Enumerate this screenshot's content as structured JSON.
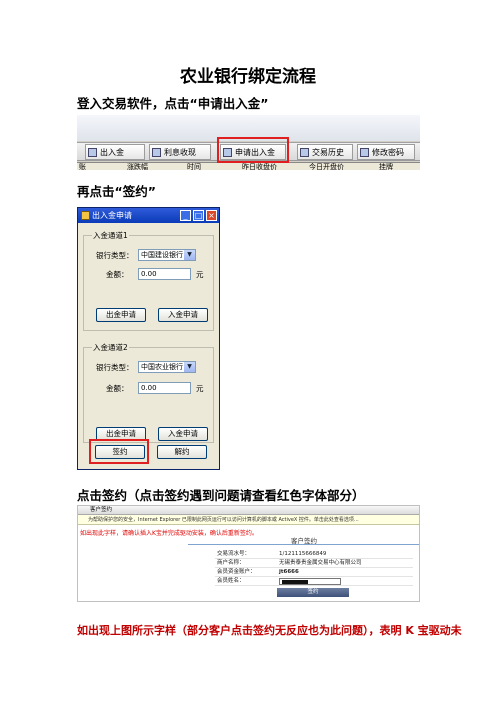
{
  "title": "农业银行绑定流程",
  "step1": "登入交易软件，点击“申请出入金”",
  "toolbar": {
    "buttons": [
      "出入金",
      "利息收现",
      "申请出入金",
      "交易历史",
      "修改密码"
    ],
    "headers": [
      "账",
      "涨跌幅",
      "时间",
      "昨日收盘价",
      "今日开盘价",
      "挂牌"
    ]
  },
  "step2": "再点击“签约”",
  "dialog": {
    "title": "出入金申请",
    "group1": {
      "label": "入金通道1",
      "bank_label": "银行类型：",
      "bank_value": "中国建设银行",
      "amount_label": "金额：",
      "amount_value": "0.00",
      "unit": "元",
      "withdraw_button": "出金申请",
      "deposit_button": "入金申请"
    },
    "group2": {
      "label": "入金通道2",
      "bank_label": "银行类型：",
      "bank_value": "中国农业银行",
      "amount_label": "金额：",
      "amount_value": "0.00",
      "unit": "元",
      "withdraw_button": "出金申请",
      "deposit_button": "入金申请"
    },
    "sign_button": "签约",
    "cancel_button": "解约"
  },
  "step3": "点击签约（点击签约遇到问题请查看红色字体部分）",
  "browser": {
    "tab": "客户签约",
    "info_bar": "为帮助保护您的安全，Internet Explorer 已限制此网页运行可以访问计算机的脚本或 ActiveX 控件。单击此处查看选项...",
    "warning": "如出现此字样，请确认插入K宝并完成驱动安装，确认后重新签约。",
    "heading": "客户签约",
    "rows": [
      {
        "key": "交易流水号：",
        "value": "1/121115666849"
      },
      {
        "key": "商户名称：",
        "value": "无锡贵泰贵金属交易中心有限公司"
      },
      {
        "key": "会员资金账户：",
        "value": "jt6666"
      },
      {
        "key": "会员姓名：",
        "value": ""
      }
    ],
    "submit": "签约"
  },
  "note": "如出现上图所示字样（部分客户点击签约无反应也为此问题），表明 K 宝驱动未"
}
